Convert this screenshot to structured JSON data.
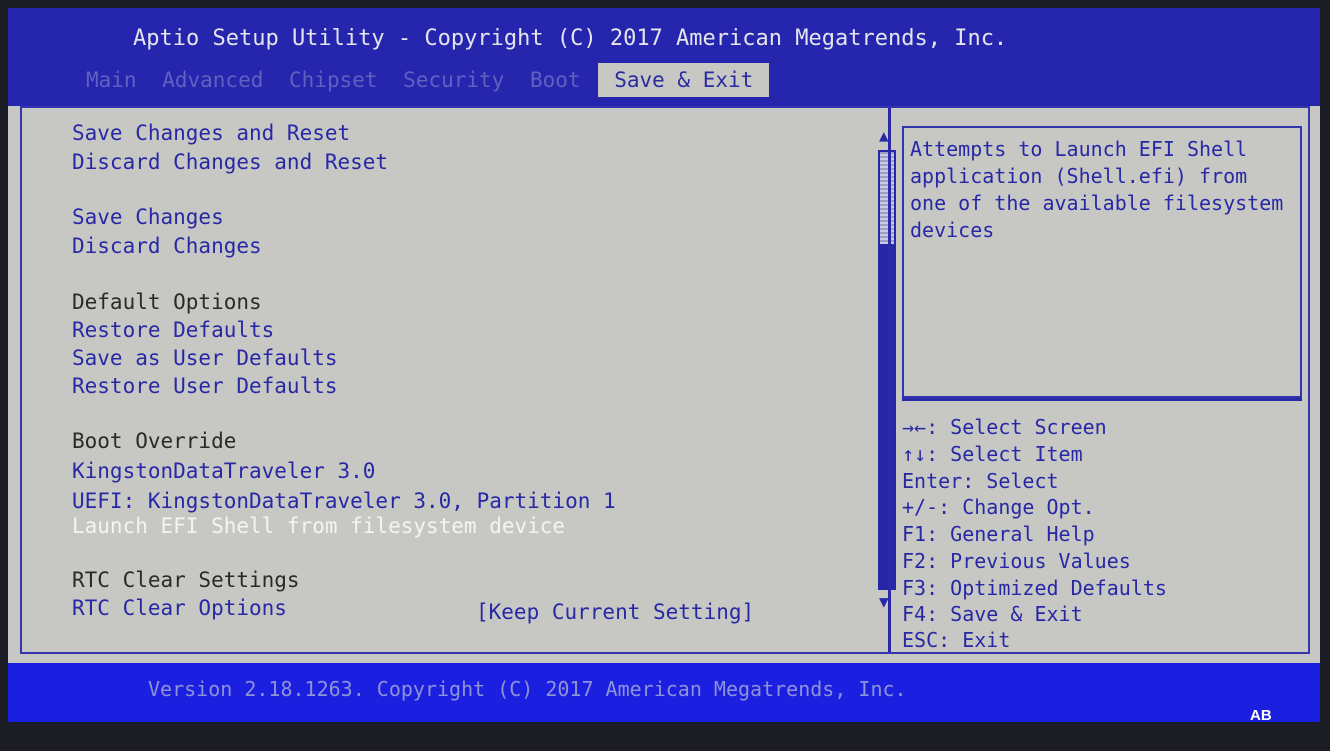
{
  "header": {
    "title": "Aptio Setup Utility - Copyright (C) 2017 American Megatrends, Inc.",
    "tabs": [
      "Main",
      "Advanced",
      "Chipset",
      "Security",
      "Boot",
      "Save & Exit"
    ],
    "active_tab": "Save & Exit"
  },
  "menu": {
    "save_changes_reset": "Save Changes and Reset",
    "discard_changes_reset": "Discard Changes and Reset",
    "save_changes": "Save Changes",
    "discard_changes": "Discard Changes",
    "default_options_header": "Default Options",
    "restore_defaults": "Restore Defaults",
    "save_user_defaults": "Save as User Defaults",
    "restore_user_defaults": "Restore User Defaults",
    "boot_override_header": "Boot Override",
    "boot_device_1": "KingstonDataTraveler 3.0",
    "boot_device_2": "UEFI: KingstonDataTraveler 3.0, Partition 1",
    "launch_efi_shell": "Launch EFI Shell from filesystem device",
    "rtc_header": "RTC Clear Settings",
    "rtc_clear_options_label": "RTC Clear Options",
    "rtc_clear_options_value": "[Keep Current Setting]",
    "selected_item": "Launch EFI Shell from filesystem device"
  },
  "scroll": {
    "up_glyph": "▲",
    "down_glyph": "▼"
  },
  "help": {
    "text": "Attempts to Launch EFI Shell application (Shell.efi) from one of the available filesystem devices"
  },
  "keys": [
    "→←: Select Screen",
    "↑↓: Select Item",
    "Enter: Select",
    "+/-: Change Opt.",
    "F1: General Help",
    "F2: Previous Values",
    "F3: Optimized Defaults",
    "F4: Save & Exit",
    "ESC: Exit"
  ],
  "footer": {
    "version": "Version 2.18.1263. Copyright (C) 2017 American Megatrends, Inc.",
    "code": "AB"
  },
  "colors": {
    "header_bg": "#2526ad",
    "body_bg": "#c7c8c4",
    "link_text": "#2828a6",
    "selected_text": "#f4f4f4",
    "footer_bg": "#1b1fe0"
  }
}
